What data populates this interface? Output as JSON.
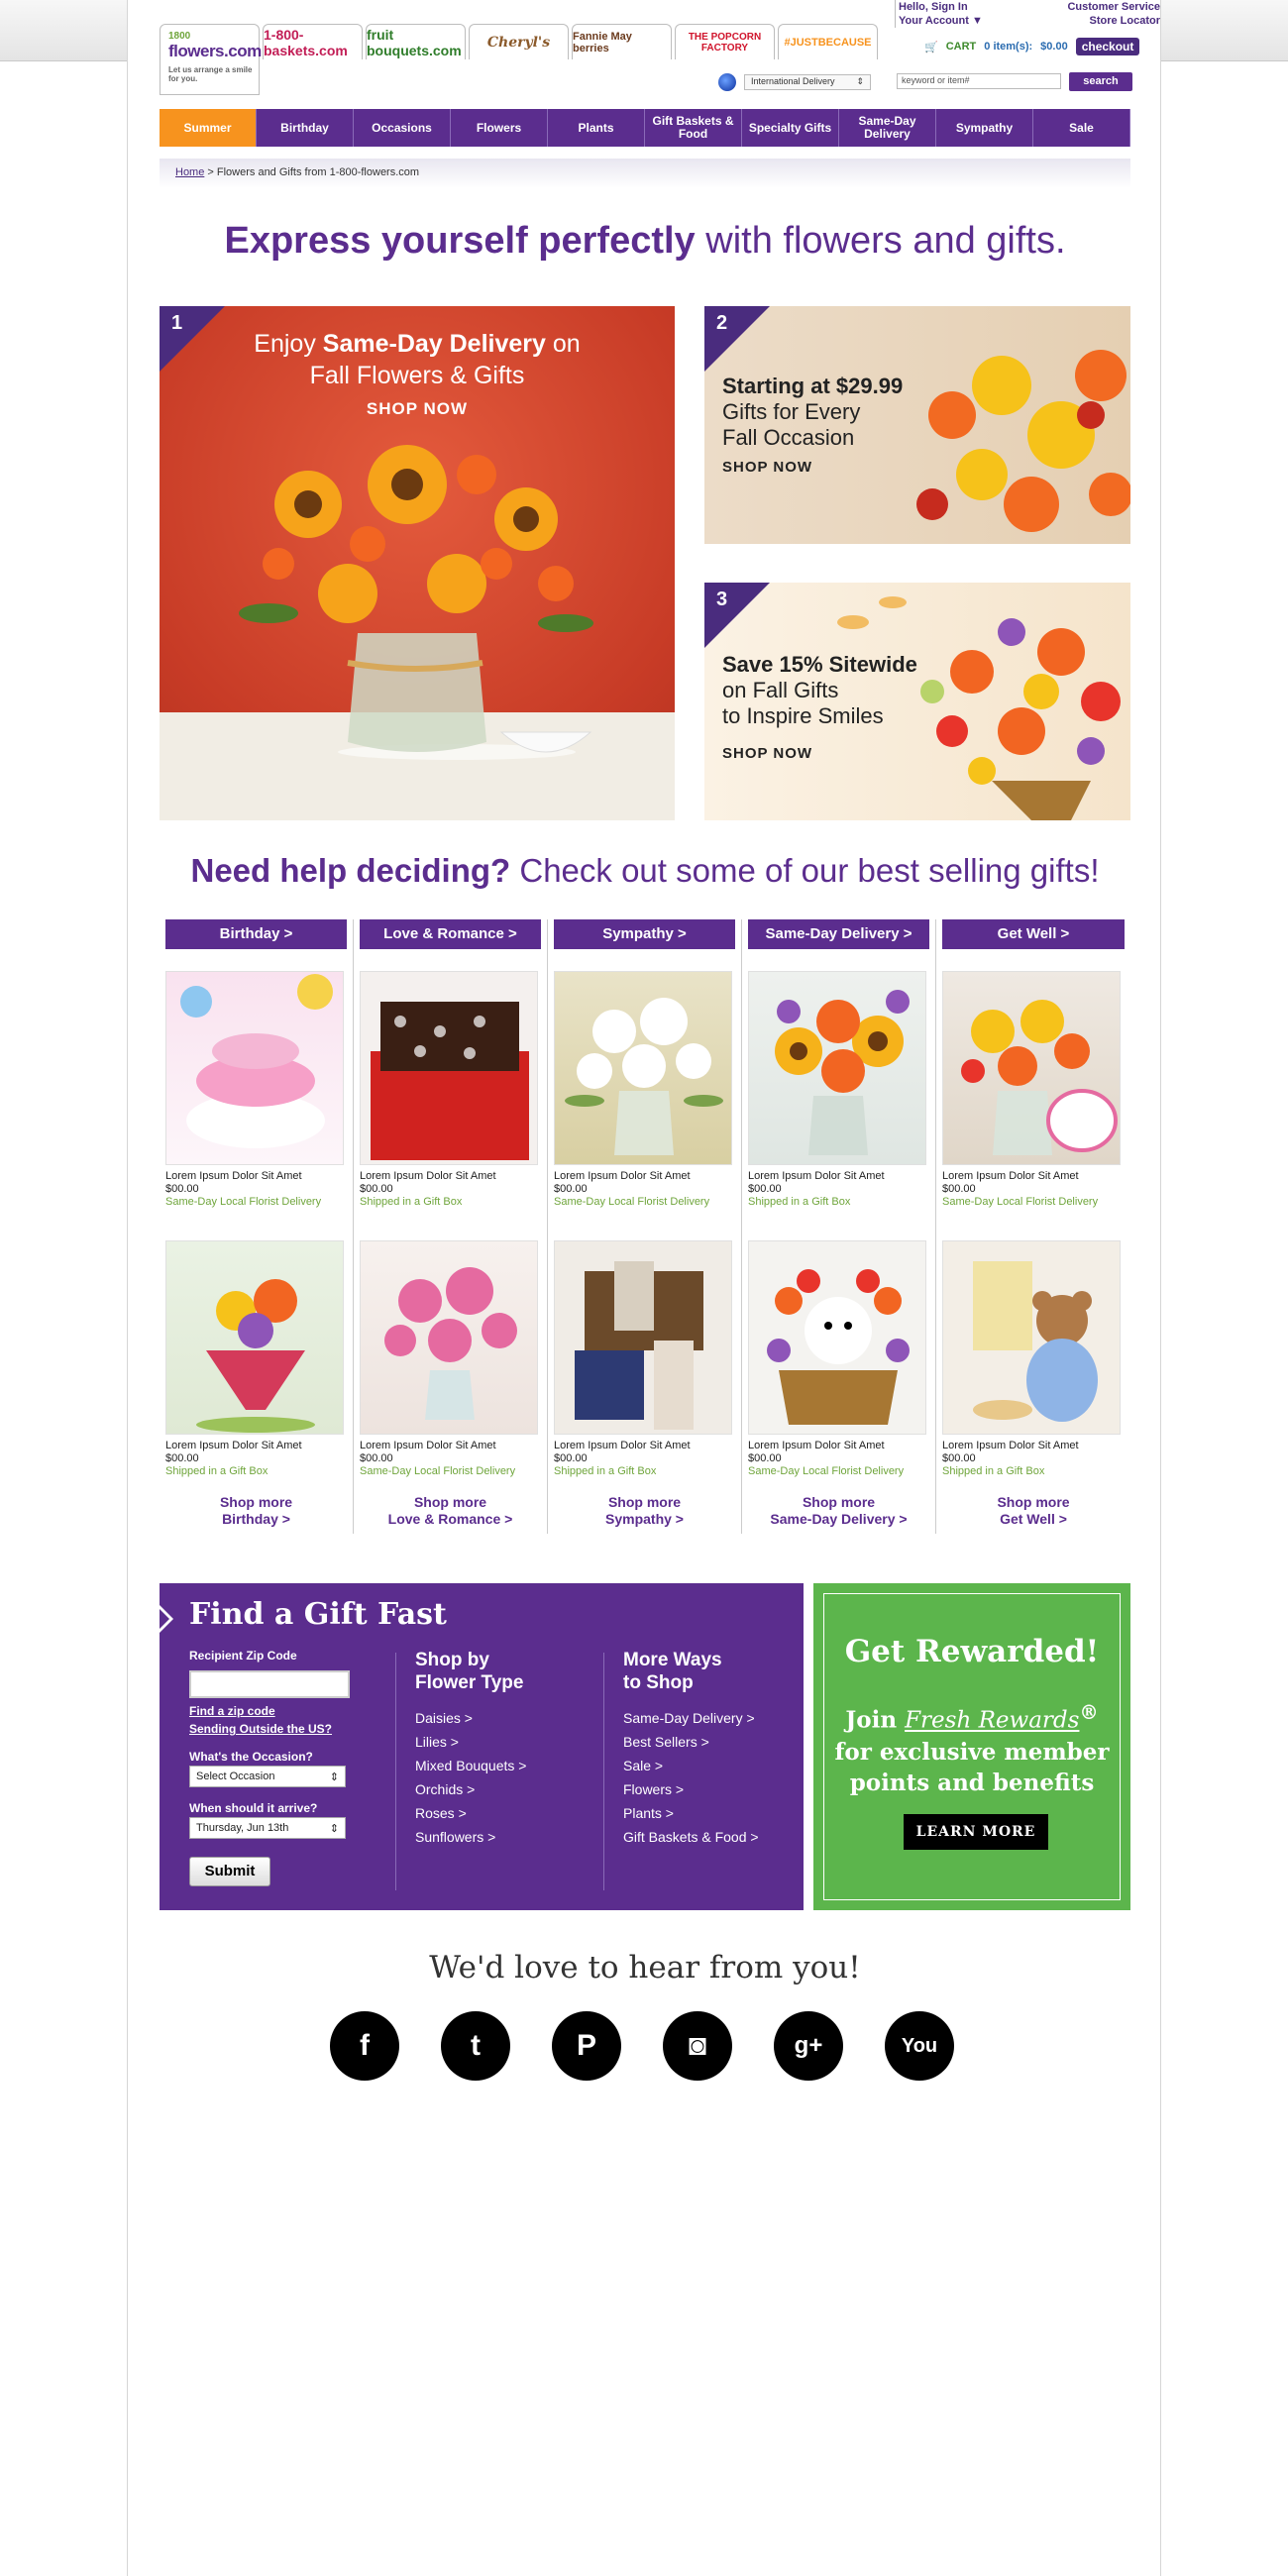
{
  "header": {
    "brands": [
      "1-800-baskets.com",
      "fruit bouquets.com",
      "Cheryl's",
      "Fannie May berries",
      "THE POPCORN FACTORY",
      "#JUSTBECAUSE"
    ],
    "logo": {
      "top": "1800",
      "name": "flowers.com",
      "tagline": "Let us arrange a smile for you."
    },
    "account": {
      "line1": "Hello, Sign In",
      "line2": "Your Account ▼"
    },
    "service": {
      "line1": "Customer Service",
      "line2": "Store Locator"
    },
    "cart": {
      "label": "CART",
      "items": "0 item(s):",
      "total": "$0.00",
      "checkout": "checkout"
    },
    "international": "International Delivery",
    "search": {
      "placeholder": "keyword or item#",
      "button": "search"
    }
  },
  "nav": [
    {
      "label": "Summer",
      "active": true
    },
    {
      "label": "Birthday"
    },
    {
      "label": "Occasions"
    },
    {
      "label": "Flowers"
    },
    {
      "label": "Plants"
    },
    {
      "label": "Gift Baskets & Food"
    },
    {
      "label": "Specialty Gifts"
    },
    {
      "label": "Same-Day Delivery"
    },
    {
      "label": "Sympathy"
    },
    {
      "label": "Sale"
    }
  ],
  "breadcrumb": {
    "home": "Home",
    "rest": "> Flowers and Gifts from 1-800-flowers.com"
  },
  "hero": {
    "bold": "Express yourself perfectly",
    "rest": " with flowers and gifts."
  },
  "banners": {
    "b1": {
      "num": "1",
      "line1a": "Enjoy ",
      "line1b": "Same-Day Delivery",
      "line1c": " on",
      "line2": "Fall Flowers & Gifts",
      "cta": "SHOP NOW"
    },
    "b2": {
      "num": "2",
      "line1": "Starting at $29.99",
      "line2": "Gifts for Every",
      "line3": "Fall Occasion",
      "cta": "SHOP NOW"
    },
    "b3": {
      "num": "3",
      "line1": "Save 15% Sitewide",
      "line2": "on Fall Gifts",
      "line3": "to Inspire Smiles",
      "cta": "SHOP NOW"
    }
  },
  "help": {
    "bold": "Need help deciding?",
    "rest": " Check out some of our best selling gifts!"
  },
  "categories": [
    {
      "title": "Birthday >",
      "more1": "Shop more",
      "more2": "Birthday >",
      "products": [
        {
          "name": "Lorem Ipsum Dolor Sit Amet",
          "price": "$00.00",
          "ship": "Same-Day Local Florist Delivery"
        },
        {
          "name": "Lorem Ipsum Dolor Sit Amet",
          "price": "$00.00",
          "ship": "Shipped in a Gift Box"
        }
      ]
    },
    {
      "title": "Love & Romance >",
      "more1": "Shop more",
      "more2": "Love & Romance >",
      "products": [
        {
          "name": "Lorem Ipsum Dolor Sit Amet",
          "price": "$00.00",
          "ship": "Shipped in a Gift Box"
        },
        {
          "name": "Lorem Ipsum Dolor Sit Amet",
          "price": "$00.00",
          "ship": "Same-Day Local Florist Delivery"
        }
      ]
    },
    {
      "title": "Sympathy >",
      "more1": "Shop more",
      "more2": "Sympathy >",
      "products": [
        {
          "name": "Lorem Ipsum Dolor Sit Amet",
          "price": "$00.00",
          "ship": "Same-Day Local Florist Delivery"
        },
        {
          "name": "Lorem Ipsum Dolor Sit Amet",
          "price": "$00.00",
          "ship": "Shipped in a Gift Box"
        }
      ]
    },
    {
      "title": "Same-Day Delivery >",
      "more1": "Shop more",
      "more2": "Same-Day Delivery >",
      "products": [
        {
          "name": "Lorem Ipsum Dolor Sit Amet",
          "price": "$00.00",
          "ship": "Shipped in a Gift Box"
        },
        {
          "name": "Lorem Ipsum Dolor Sit Amet",
          "price": "$00.00",
          "ship": "Same-Day Local Florist Delivery"
        }
      ]
    },
    {
      "title": "Get Well >",
      "more1": "Shop more",
      "more2": "Get Well >",
      "products": [
        {
          "name": "Lorem Ipsum Dolor Sit Amet",
          "price": "$00.00",
          "ship": "Same-Day Local Florist Delivery"
        },
        {
          "name": "Lorem Ipsum Dolor Sit Amet",
          "price": "$00.00",
          "ship": "Shipped in a Gift Box"
        }
      ]
    }
  ],
  "find": {
    "title": "Find a Gift Fast",
    "zip_label": "Recipient Zip Code",
    "find_zip": "Find a zip code",
    "outside": "Sending Outside the US?",
    "occasion_label": "What's the Occasion?",
    "occasion_value": "Select Occasion",
    "arrive_label": "When should it arrive?",
    "arrive_value": "Thursday, Jun 13th",
    "submit": "Submit",
    "col1_title1": "Shop by",
    "col1_title2": "Flower Type",
    "col1": [
      "Daisies >",
      "Lilies >",
      "Mixed Bouquets >",
      "Orchids >",
      "Roses >",
      "Sunflowers >"
    ],
    "col2_title1": "More Ways",
    "col2_title2": "to Shop",
    "col2": [
      "Same-Day Delivery >",
      "Best Sellers >",
      "Sale >",
      "Flowers >",
      "Plants >",
      "Gift Baskets & Food >"
    ]
  },
  "rewards": {
    "title": "Get Rewarded!",
    "join": "Join ",
    "program": "Fresh Rewards",
    "reg": "®",
    "line2": "for exclusive member",
    "line3": "points and benefits",
    "button": "LEARN MORE"
  },
  "hear": "We'd love to hear from you!",
  "socials": [
    {
      "name": "facebook-icon",
      "glyph": "f"
    },
    {
      "name": "twitter-icon",
      "glyph": "t"
    },
    {
      "name": "pinterest-icon",
      "glyph": "P"
    },
    {
      "name": "instagram-icon",
      "glyph": "◙"
    },
    {
      "name": "google-plus-icon",
      "glyph": "g+"
    },
    {
      "name": "youtube-icon",
      "glyph": "You"
    }
  ],
  "colors": {
    "purple": "#5b2d8e",
    "orange": "#f7931e",
    "green": "#5cb54c",
    "link_green": "#6fa53b"
  }
}
